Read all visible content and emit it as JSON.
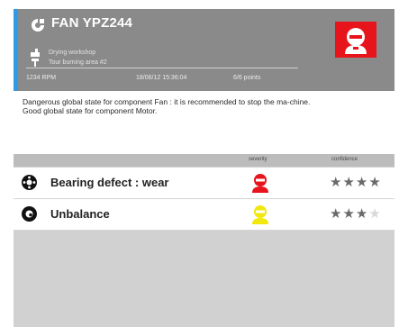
{
  "component": {
    "title": "FAN YPZ244",
    "location": "Drying workshop",
    "sublocation": "Tour burning area #2",
    "rpm": "1234 RPM",
    "timestamp": "18/06/12 15:36:04",
    "points": "6/6 points",
    "alarm_color": "#e8141c"
  },
  "message": {
    "line1": "Dangerous global state for component Fan : it is recommended to stop the ma-chine.",
    "line2": "Good global state for component Motor."
  },
  "table": {
    "col_severity": "severity",
    "col_confidence": "confidence",
    "rows": [
      {
        "name": "Bearing defect : wear",
        "severity_color": "#e8141c",
        "confidence_stars": 4,
        "icon": "bearing-icon"
      },
      {
        "name": "Unbalance",
        "severity_color": "#f2e80c",
        "confidence_stars": 3,
        "icon": "unbalance-icon"
      }
    ]
  },
  "colors": {
    "accent": "#2f9be8",
    "header_bg": "#8a8a8a",
    "danger": "#e8141c",
    "warning": "#f2e80c"
  }
}
